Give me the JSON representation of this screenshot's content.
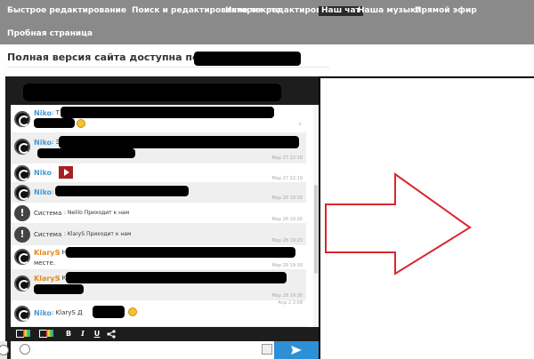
{
  "nav": {
    "items": [
      {
        "label": "Быстрое редактирование"
      },
      {
        "label": "Поиск и редактирование текста"
      },
      {
        "label": "История редактирования"
      },
      {
        "label": "Наш чат",
        "active": true
      },
      {
        "label": "Наша музыка"
      },
      {
        "label": "Прямой эфир"
      },
      {
        "label": "Пробная страница"
      }
    ]
  },
  "heading": {
    "text": "Полная версия сайта доступна по адресу:"
  },
  "chat": {
    "messages": [
      {
        "nick": "Niko",
        "nick_color": "#4a9ad6",
        "text_prefix": ": T",
        "timestamp": "",
        "delete": "x"
      },
      {
        "nick": "Niko",
        "nick_color": "#4a9ad6",
        "text_prefix": ": Э",
        "timestamp": "Мар 27 22:18",
        "delete": "x"
      },
      {
        "nick": "Niko",
        "nick_color": "#4a9ad6",
        "text_prefix": "",
        "timestamp": "Мар 27 22:19",
        "delete": "x"
      },
      {
        "nick": "Niko",
        "nick_color": "#4a9ad6",
        "text_prefix": ":",
        "timestamp": "Мар 28 19:09",
        "delete": "x"
      },
      {
        "system": "Система",
        "text": ": Nelilo Приходит к нам",
        "timestamp": "Мар 28 19:26",
        "delete": "x"
      },
      {
        "system": "Система",
        "text": ": KlaryS Приходит к нам",
        "timestamp": "Мар 28 19:29",
        "delete": "x"
      },
      {
        "nick": "KlaryS",
        "nick_color": "#e88a1a",
        "text_prefix": ": Н",
        "text_suffix": "месте.",
        "timestamp": "Мар 28 19:30",
        "delete": "x"
      },
      {
        "nick": "KlaryS",
        "nick_color": "#e88a1a",
        "text_prefix": ": К",
        "timestamp": "Мар 28 19:36",
        "delete": "x"
      },
      {
        "nick": "Niko",
        "nick_color": "#4a9ad6",
        "text_prefix": ": KlaryS Д",
        "timestamp": "Апр 2 2:08",
        "delete": "x"
      }
    ],
    "toolbar": {
      "bold": "B",
      "italic": "I",
      "underline": "U"
    },
    "input": {
      "placeholder": ""
    }
  },
  "colors": {
    "nav_bg": "#8a8a8a",
    "chat_bg": "#1d1d1d",
    "send_button": "#2d8fd5",
    "arrow": "#d9262c"
  },
  "icons": {
    "send": "paper-plane-icon",
    "emoji": "smiley-icon",
    "image": "image-icon",
    "share": "share-icon"
  }
}
